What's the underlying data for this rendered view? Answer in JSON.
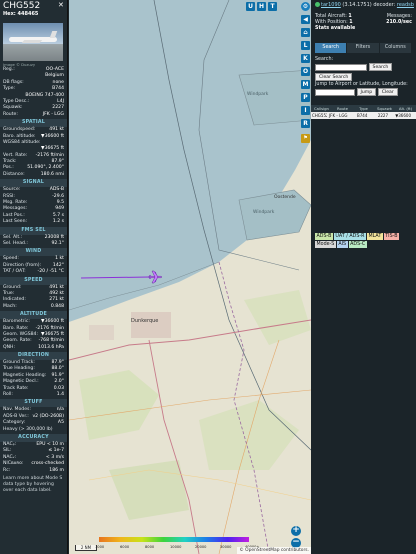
{
  "flight": {
    "callsign": "CHG552",
    "hex_label": "Hex: 448465",
    "image_credit": "Image © Duzuzy"
  },
  "details": [
    {
      "label": "Reg.:",
      "value": "OO-ACE"
    },
    {
      "label": "",
      "value": "Belgium"
    },
    {
      "label": "DB flags:",
      "value": "none"
    },
    {
      "label": "Type:",
      "value": "B744"
    },
    {
      "label": "",
      "value": "BOEING 747-400"
    },
    {
      "label": "Type Desc.:",
      "value": "L4J"
    },
    {
      "label": "Squawk:",
      "value": "2227"
    },
    {
      "label": "Route:",
      "value": "JFK - LGG"
    }
  ],
  "sections": [
    {
      "title": "SPATIAL",
      "rows": [
        {
          "label": "Groundspeed:",
          "value": "491 kt"
        },
        {
          "label": "Baro. altitude:",
          "value": "▼36600 ft"
        },
        {
          "label": "WGS84 altitude:",
          "value": ""
        },
        {
          "label": "",
          "value": "▼36675 ft"
        },
        {
          "label": "Vert. Rate:",
          "value": "-2176 ft/min"
        },
        {
          "label": "Track:",
          "value": "87.9°"
        },
        {
          "label": "Pos.:",
          "value": "51.090°, 2.400°"
        },
        {
          "label": "Distance:",
          "value": "180.6 nmi"
        }
      ]
    },
    {
      "title": "SIGNAL",
      "rows": [
        {
          "label": "Source:",
          "value": "ADS-B"
        },
        {
          "label": "RSSI:",
          "value": "-29.6"
        },
        {
          "label": "Msg. Rate:",
          "value": "9.5"
        },
        {
          "label": "Messages:",
          "value": "949"
        },
        {
          "label": "Last Pos.:",
          "value": "5.7 s"
        },
        {
          "label": "Last Seen:",
          "value": "1.2 s"
        }
      ]
    },
    {
      "title": "FMS SEL",
      "rows": [
        {
          "label": "Sel. Alt.:",
          "value": "23008 ft"
        },
        {
          "label": "Sel. Head.:",
          "value": "92.1°"
        }
      ]
    },
    {
      "title": "WIND",
      "rows": [
        {
          "label": "Speed:",
          "value": "1 kt"
        },
        {
          "label": "Direction (from):",
          "value": "142°"
        },
        {
          "label": "TAT / OAT:",
          "value": "-20 / -51 °C"
        }
      ]
    },
    {
      "title": "SPEED",
      "rows": [
        {
          "label": "Ground:",
          "value": "491 kt"
        },
        {
          "label": "True:",
          "value": "492 kt"
        },
        {
          "label": "Indicated:",
          "value": "271 kt"
        },
        {
          "label": "Mach:",
          "value": "0.848"
        }
      ]
    },
    {
      "title": "ALTITUDE",
      "rows": [
        {
          "label": "Barometric:",
          "value": "▼36600 ft"
        },
        {
          "label": "Baro. Rate:",
          "value": "-2176 ft/min"
        },
        {
          "label": "Geom. WGS84:",
          "value": "▼36675 ft"
        },
        {
          "label": "Geom. Rate:",
          "value": "-768 ft/min"
        },
        {
          "label": "QNH:",
          "value": "1013.6 hPa"
        }
      ]
    },
    {
      "title": "DIRECTION",
      "rows": [
        {
          "label": "Ground Track:",
          "value": "87.9°"
        },
        {
          "label": "True Heading:",
          "value": "88.0°"
        },
        {
          "label": "Magnetic Heading:",
          "value": "91.9°"
        },
        {
          "label": "Magnetic Decl.:",
          "value": "2.0°"
        },
        {
          "label": "Track Rate:",
          "value": "0.03"
        },
        {
          "label": "Roll:",
          "value": "1.4"
        }
      ]
    },
    {
      "title": "STUFF",
      "rows": [
        {
          "label": "Nav. Modes:",
          "value": "n/a"
        },
        {
          "label": "ADS-B Ver.:",
          "value": "v2 (DO-260B)"
        },
        {
          "label": "Category:",
          "value": "A5"
        },
        {
          "label": "Heavy (> 300,000 lb)",
          "value": ""
        }
      ]
    },
    {
      "title": "ACCURACY",
      "rows": [
        {
          "label": "NACₚ:",
          "value": "EPU < 10 m"
        },
        {
          "label": "SIL:",
          "value": "≤ 1e-7"
        },
        {
          "label": "NACᵥ:",
          "value": "< 3 m/s"
        },
        {
          "label": "NICʙᴀʀᴏ:",
          "value": "cross-checked"
        },
        {
          "label": "Rᴄ:",
          "value": "186 m"
        }
      ]
    }
  ],
  "footer_note": "Learn more about Mode S data type by hovering over each data label.",
  "map": {
    "top_buttons": [
      "U",
      "H",
      "T"
    ],
    "side_buttons": [
      "L",
      "K",
      "O",
      "M",
      "P",
      "I",
      "R"
    ],
    "labels": {
      "dunkerque": "Dunkerque",
      "windpark1": "Windpark",
      "windpark2": "Windpark",
      "ostend": "Oostende"
    },
    "scale_label": "2 NM",
    "attribution": "© OpenStreetMap contributors.",
    "zoom_in": "+",
    "zoom_out": "−",
    "colorbar_ticks": [
      "2000",
      "6000",
      "8000",
      "10000",
      "20000",
      "30000",
      "40000+"
    ]
  },
  "right_panel": {
    "version_link": "tar1090",
    "version_text": " (3.14.1751) decoder:",
    "decoder_link": "readsb",
    "stats": [
      {
        "label": "Total Aircraft:",
        "value": "1"
      },
      {
        "label": "Messages:",
        "value": "210.0/sec"
      },
      {
        "label": "With Position:",
        "value": "1"
      },
      {
        "label": "Stats available",
        "value": ""
      }
    ],
    "tabs": [
      "Search",
      "Filters",
      "Columns"
    ],
    "search_label": "Search:",
    "search_button": "Search",
    "clear_search_button": "Clear Search",
    "jump_label": "Jump to Airport or Latitude, Longitude:",
    "jump_button": "Jump",
    "clear_button": "Clear",
    "table_headers": [
      "Callsign",
      "Route",
      "Type",
      "Squawk",
      "Alt. (ft)"
    ],
    "table_row": {
      "callsign": "CHG552",
      "route": "JFK - LGG",
      "type": "B744",
      "squawk": "2227",
      "alt": "▼36600"
    },
    "chips": [
      {
        "text": "ADS-B",
        "color": "#c9e6a9"
      },
      {
        "text": "UAT / ADS-R",
        "color": "#a8dfe6"
      },
      {
        "text": "MLAT",
        "color": "#f2e49b"
      },
      {
        "text": "TIS-B",
        "color": "#f7b2a8"
      },
      {
        "text": "Mode-S",
        "color": "#d8d8d8"
      },
      {
        "text": "AIS",
        "color": "#b5d3f0"
      },
      {
        "text": "ADS-C",
        "color": "#b9eac3"
      }
    ]
  }
}
